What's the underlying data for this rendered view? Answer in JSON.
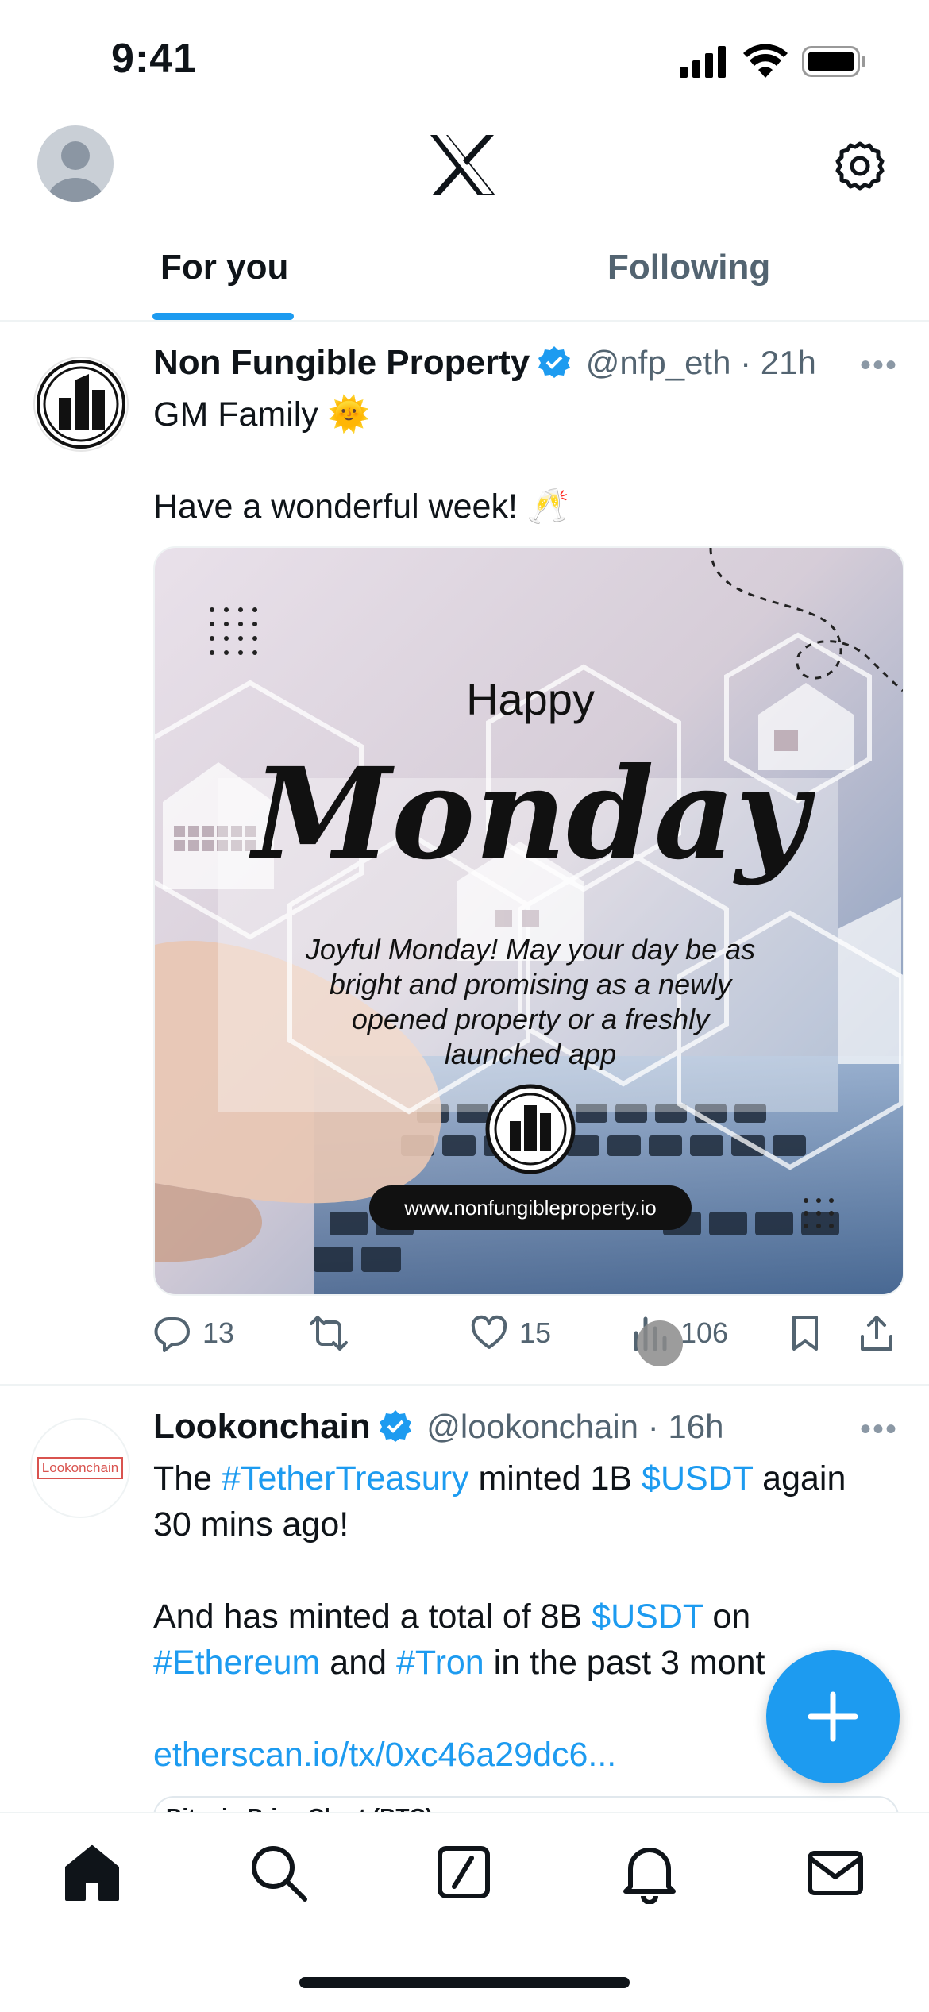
{
  "status_bar": {
    "time": "9:41"
  },
  "header": {
    "logo": "x-logo-icon",
    "settings_icon": "gear-icon",
    "avatar_icon": "default-avatar-icon"
  },
  "tabs": [
    {
      "label": "For you",
      "active": true
    },
    {
      "label": "Following",
      "active": false
    }
  ],
  "tweets": [
    {
      "name": "Non Fungible Property",
      "verified": true,
      "handle": "@nfp_eth",
      "time": "21h",
      "text_line1": "GM Family 🌞",
      "text_line2": "Have a wonderful week! 🥂",
      "media": {
        "title_small": "Happy",
        "title_big": "Monday",
        "caption": [
          "Joyful Monday! May your day be as",
          "bright and promising as a newly",
          "opened property or a freshly",
          "launched app"
        ],
        "url": "www.nonfungibleproperty.io"
      },
      "actions": {
        "replies": "13",
        "likes": "15",
        "views": "106"
      }
    },
    {
      "name": "Lookonchain",
      "avatar_text": "Lookonchain",
      "verified": true,
      "handle": "@lookonchain",
      "time": "16h",
      "p1": {
        "a": "The ",
        "tag1": "#TetherTreasury",
        "b": " minted 1B ",
        "tag2": "$USDT",
        "c": " again",
        "d": "30 mins ago!"
      },
      "p2": {
        "a": "And has minted a total of 8B ",
        "tag1": "$USDT",
        "b": " on",
        "tag2": "#Ethereum",
        "c": " and ",
        "tag3": "#Tron",
        "d": " in the past 3 mont"
      },
      "link": "etherscan.io/tx/0xc46a29dc6...",
      "card_title": "Bitcoin Price Chart (BTC)"
    }
  ],
  "colors": {
    "accent": "#1d9bf0",
    "text": "#0f1419",
    "secondary": "#536471"
  },
  "nav": [
    "home-icon",
    "search-icon",
    "compose-icon",
    "bell-icon",
    "mail-icon"
  ]
}
